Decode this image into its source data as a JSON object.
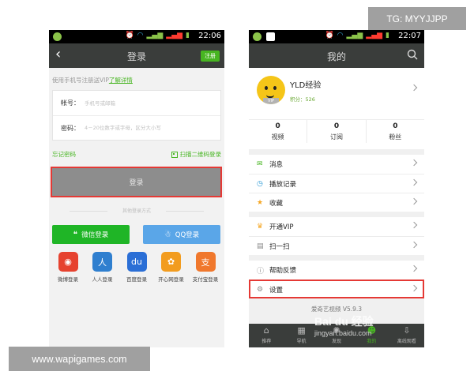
{
  "watermarks": {
    "tg": "TG: MYYJJPP",
    "site": "www.wapigames.com",
    "baidu": "Bai du 经验",
    "baidu_url": "jingyan.baidu.com"
  },
  "login": {
    "status_time": "22:06",
    "title": "登录",
    "register": "注册",
    "hint": "使用手机号注册送VIP",
    "hint_link": "了解详情",
    "account_label": "帐号：",
    "account_placeholder": "手机号或邮箱",
    "password_label": "密码：",
    "password_placeholder": "4－20位数字或字母，区分大小写",
    "forgot": "忘记密码",
    "qr_login": "扫描二维码登录",
    "login_button": "登录",
    "other_methods": "其他登录方式",
    "wechat_login": "微信登录",
    "qq_login": "QQ登录",
    "apps": [
      {
        "label": "微博登录",
        "color": "#e6422f",
        "glyph": "◉"
      },
      {
        "label": "人人登录",
        "color": "#2f7fcf",
        "glyph": "人"
      },
      {
        "label": "百度登录",
        "color": "#2b6fd6",
        "glyph": "du"
      },
      {
        "label": "开心网登录",
        "color": "#f29c1f",
        "glyph": "✿"
      },
      {
        "label": "支付宝登录",
        "color": "#f0782d",
        "glyph": "支"
      }
    ]
  },
  "profile": {
    "status_time": "22:07",
    "title": "我的",
    "username": "YLD经验",
    "score": "积分：526",
    "vip_badge": "VIP",
    "stats": [
      {
        "value": "0",
        "label": "视频"
      },
      {
        "value": "0",
        "label": "订阅"
      },
      {
        "value": "0",
        "label": "粉丝"
      }
    ],
    "menu_groups": [
      [
        {
          "label": "消息",
          "icon": "message-icon",
          "glyph": "✉",
          "color": "#47b521"
        },
        {
          "label": "播放记录",
          "icon": "history-icon",
          "glyph": "◷",
          "color": "#2e9bd6"
        },
        {
          "label": "收藏",
          "icon": "star-icon",
          "glyph": "★",
          "color": "#f5a623"
        }
      ],
      [
        {
          "label": "开通VIP",
          "icon": "crown-icon",
          "glyph": "♛",
          "color": "#f5a623"
        },
        {
          "label": "扫一扫",
          "icon": "scan-icon",
          "glyph": "▤",
          "color": "#888888"
        }
      ],
      [
        {
          "label": "帮助反馈",
          "icon": "help-icon",
          "glyph": "ⓘ",
          "color": "#888888"
        },
        {
          "label": "设置",
          "icon": "settings-icon",
          "glyph": "⚙",
          "color": "#888888"
        }
      ]
    ],
    "version": "爱奇艺视频 V5.9.3",
    "nav": [
      {
        "label": "推荐",
        "icon": "home-icon",
        "glyph": "⌂"
      },
      {
        "label": "导航",
        "icon": "grid-icon",
        "glyph": "▦"
      },
      {
        "label": "发现",
        "icon": "discover-icon",
        "glyph": "✺"
      },
      {
        "label": "我的",
        "icon": "user-icon",
        "glyph": "☻"
      },
      {
        "label": "离线观看",
        "icon": "download-icon",
        "glyph": "⇩"
      }
    ],
    "active_nav": 3,
    "highlight_item": "设置"
  },
  "colors": {
    "accent_green": "#47b521",
    "highlight_red": "#e53935",
    "titlebar": "#3a3d3b"
  }
}
